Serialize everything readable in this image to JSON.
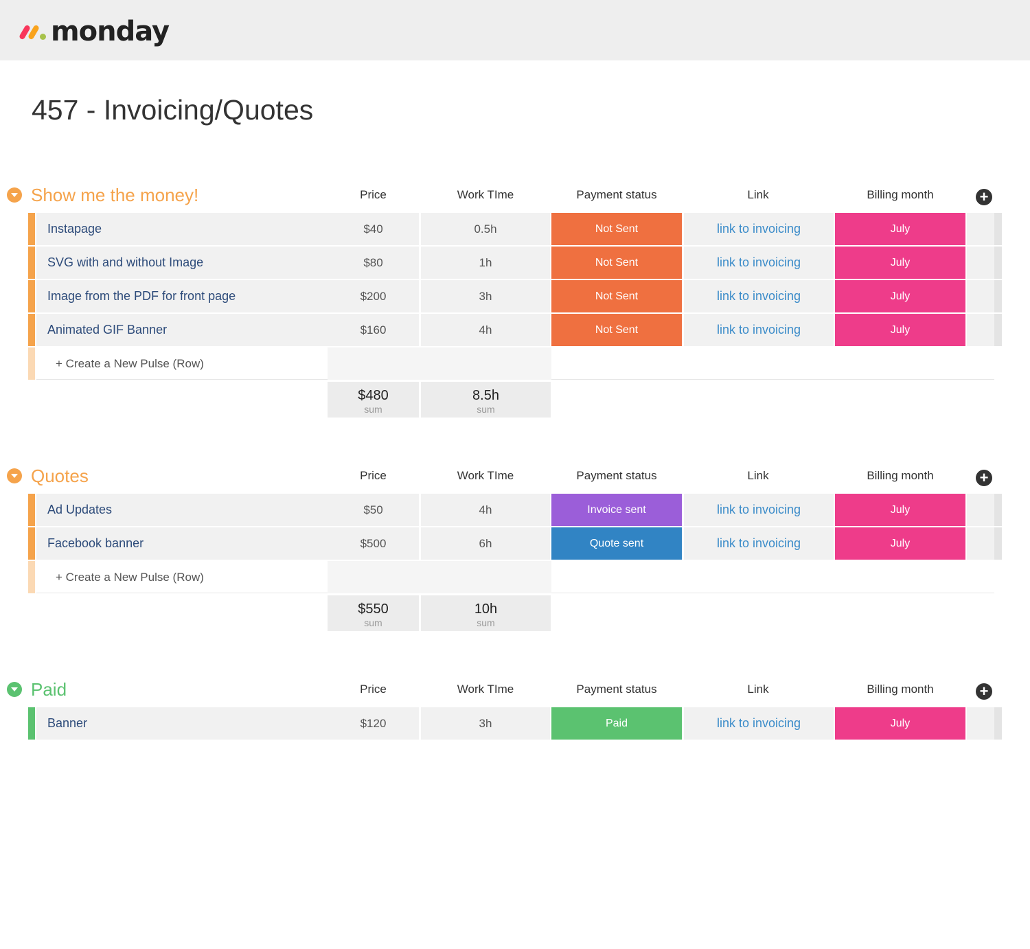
{
  "app": {
    "name": "monday",
    "logo_colors": [
      "#f9365b",
      "#f9a31c",
      "#a7c24a"
    ]
  },
  "board": {
    "title": "457 - Invoicing/Quotes"
  },
  "columns": {
    "price": "Price",
    "work_time": "Work TIme",
    "payment_status": "Payment status",
    "link": "Link",
    "billing_month": "Billing month"
  },
  "add_column_label": "+",
  "new_pulse_label": "+ Create a New Pulse (Row)",
  "sum_label": "sum",
  "colors": {
    "not_sent": "#ef7040",
    "invoice_sent": "#9b5ed9",
    "quote_sent": "#3184c4",
    "paid": "#5bc270",
    "july": "#ee3c8a",
    "group_orange": "#f5a34b",
    "group_green": "#5bc270"
  },
  "groups": [
    {
      "title": "Show me the money!",
      "color": "#f5a34b",
      "rows": [
        {
          "name": "Instapage",
          "price": "$40",
          "work_time": "0.5h",
          "status": "Not Sent",
          "status_color": "#ef7040",
          "link": "link to invoicing",
          "month": "July",
          "month_color": "#ee3c8a"
        },
        {
          "name": "SVG with and without Image",
          "price": "$80",
          "work_time": "1h",
          "status": "Not Sent",
          "status_color": "#ef7040",
          "link": "link to invoicing",
          "month": "July",
          "month_color": "#ee3c8a"
        },
        {
          "name": "Image from the PDF for front page",
          "price": "$200",
          "work_time": "3h",
          "status": "Not Sent",
          "status_color": "#ef7040",
          "link": "link to invoicing",
          "month": "July",
          "month_color": "#ee3c8a"
        },
        {
          "name": "Animated GIF Banner",
          "price": "$160",
          "work_time": "4h",
          "status": "Not Sent",
          "status_color": "#ef7040",
          "link": "link to invoicing",
          "month": "July",
          "month_color": "#ee3c8a"
        }
      ],
      "sum": {
        "price": "$480",
        "work_time": "8.5h"
      }
    },
    {
      "title": "Quotes",
      "color": "#f5a34b",
      "rows": [
        {
          "name": "Ad Updates",
          "price": "$50",
          "work_time": "4h",
          "status": "Invoice sent",
          "status_color": "#9b5ed9",
          "link": "link to invoicing",
          "month": "July",
          "month_color": "#ee3c8a"
        },
        {
          "name": "Facebook banner",
          "price": "$500",
          "work_time": "6h",
          "status": "Quote sent",
          "status_color": "#3184c4",
          "link": "link to invoicing",
          "month": "July",
          "month_color": "#ee3c8a"
        }
      ],
      "sum": {
        "price": "$550",
        "work_time": "10h"
      }
    },
    {
      "title": "Paid",
      "color": "#5bc270",
      "rows": [
        {
          "name": "Banner",
          "price": "$120",
          "work_time": "3h",
          "status": "Paid",
          "status_color": "#5bc270",
          "link": "link to invoicing",
          "month": "July",
          "month_color": "#ee3c8a"
        }
      ]
    }
  ]
}
